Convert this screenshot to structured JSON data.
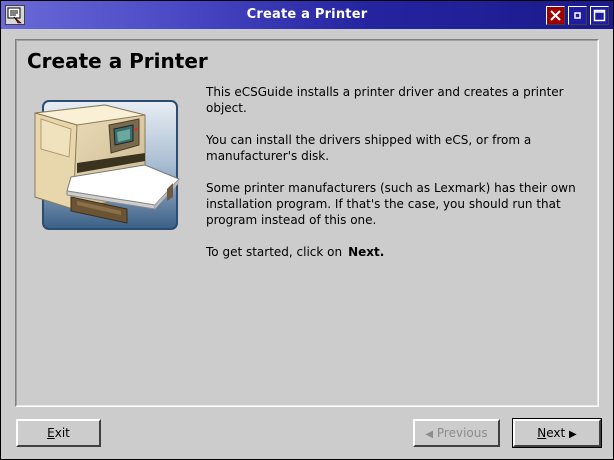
{
  "window": {
    "title": "Create a Printer",
    "icons": {
      "app": "printer-app-icon",
      "close": "close-icon",
      "minimize": "minimize-icon",
      "maximize": "maximize-icon"
    }
  },
  "main": {
    "heading": "Create a Printer",
    "paragraphs": [
      "This eCSGuide installs a printer driver and creates a printer object.",
      "You can install the drivers shipped with eCS, or from a manufacturer's disk.",
      "Some printer manufacturers (such as Lexmark) has their own installation program.   If that's the case, you should run that program instead of this one.",
      "To get started, click on"
    ],
    "next_emphasis": "Next."
  },
  "buttons": {
    "exit": "xit",
    "exit_mnemonic": "E",
    "previous": "Previous",
    "next_mnemonic": "N",
    "next": "ext"
  },
  "colors": {
    "titlebar_start": "#6a6ad8",
    "titlebar_end": "#1a1a8c",
    "close_button": "#a00000",
    "face": "#cccccc"
  }
}
